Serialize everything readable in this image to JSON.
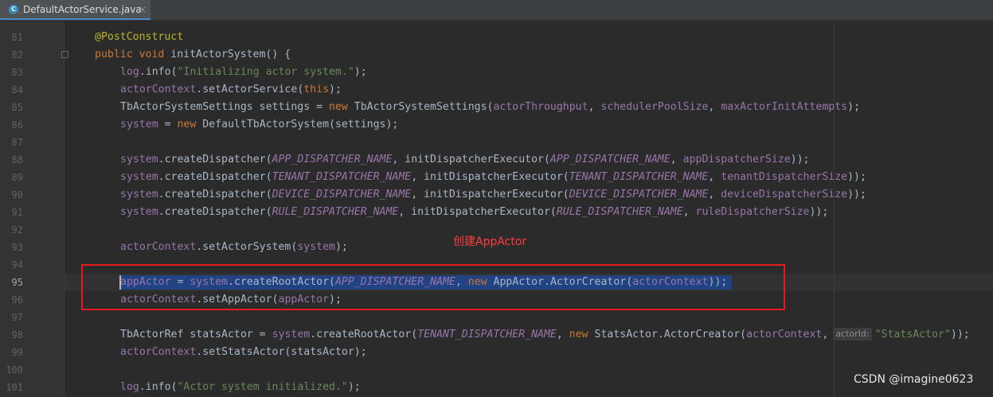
{
  "tab": {
    "title": "DefaultActorService.java",
    "icon": "java-class-icon",
    "close": "×"
  },
  "annotation_label": "创建AppActor",
  "watermark": "CSDN @imagine0623",
  "top_line_number": "80",
  "lines": [
    {
      "n": "81"
    },
    {
      "n": "82"
    },
    {
      "n": "83"
    },
    {
      "n": "84"
    },
    {
      "n": "85"
    },
    {
      "n": "86"
    },
    {
      "n": "87"
    },
    {
      "n": "88"
    },
    {
      "n": "89"
    },
    {
      "n": "90"
    },
    {
      "n": "91"
    },
    {
      "n": "92"
    },
    {
      "n": "93"
    },
    {
      "n": "94"
    },
    {
      "n": "95"
    },
    {
      "n": "96"
    },
    {
      "n": "97"
    },
    {
      "n": "98"
    },
    {
      "n": "99"
    },
    {
      "n": "100"
    },
    {
      "n": "101"
    }
  ],
  "current_line": "95",
  "code": {
    "l81": [
      "@PostConstruct"
    ],
    "l82": [
      "public",
      " ",
      "void",
      " initActorSystem() {"
    ],
    "l83": [
      "log",
      ".info(",
      "\"Initializing actor system.\"",
      ");"
    ],
    "l84": [
      "actorContext",
      ".setActorService(",
      "this",
      ");"
    ],
    "l85": [
      "TbActorSystemSettings settings = ",
      "new",
      " TbActorSystemSettings(",
      "actorThroughput",
      ", ",
      "schedulerPoolSize",
      ", ",
      "maxActorInitAttempts",
      ");"
    ],
    "l86": [
      "system",
      " = ",
      "new",
      " DefaultTbActorSystem(settings);"
    ],
    "l88": [
      "system",
      ".createDispatcher(",
      "APP_DISPATCHER_NAME",
      ", initDispatcherExecutor(",
      "APP_DISPATCHER_NAME",
      ", ",
      "appDispatcherSize",
      "));"
    ],
    "l89": [
      "system",
      ".createDispatcher(",
      "TENANT_DISPATCHER_NAME",
      ", initDispatcherExecutor(",
      "TENANT_DISPATCHER_NAME",
      ", ",
      "tenantDispatcherSize",
      "));"
    ],
    "l90": [
      "system",
      ".createDispatcher(",
      "DEVICE_DISPATCHER_NAME",
      ", initDispatcherExecutor(",
      "DEVICE_DISPATCHER_NAME",
      ", ",
      "deviceDispatcherSize",
      "));"
    ],
    "l91": [
      "system",
      ".createDispatcher(",
      "RULE_DISPATCHER_NAME",
      ", initDispatcherExecutor(",
      "RULE_DISPATCHER_NAME",
      ", ",
      "ruleDispatcherSize",
      "));"
    ],
    "l93": [
      "actorContext",
      ".setActorSystem(",
      "system",
      ");"
    ],
    "l95": [
      "appActor",
      " = ",
      "system",
      ".createRootActor(",
      "APP_DISPATCHER_NAME",
      ", ",
      "new",
      " AppActor.ActorCreator(",
      "actorContext",
      "));"
    ],
    "l96": [
      "actorContext",
      ".setAppActor(",
      "appActor",
      ");"
    ],
    "l98": [
      "TbActorRef statsActor = ",
      "system",
      ".createRootActor(",
      "TENANT_DISPATCHER_NAME",
      ", ",
      "new",
      " StatsActor.ActorCreator(",
      "actorContext",
      ",",
      "actorId:",
      "\"StatsActor\"",
      "));"
    ],
    "l99": [
      "actorContext",
      ".setStatsActor(statsActor);"
    ],
    "l101": [
      "log",
      ".info(",
      "\"Actor system initialized.\"",
      ");"
    ]
  }
}
